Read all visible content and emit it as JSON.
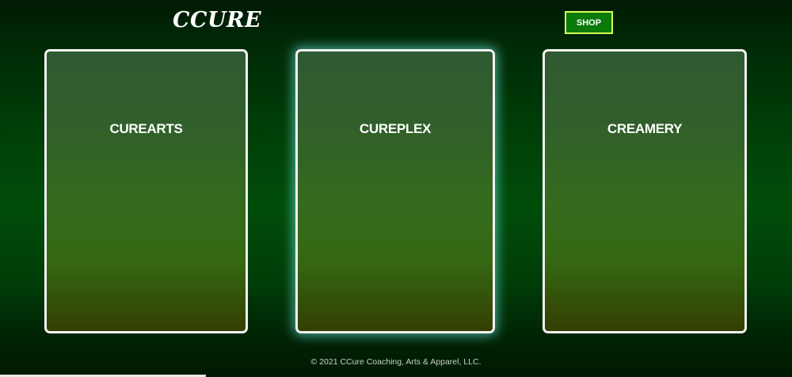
{
  "header": {
    "logo": "CCURE",
    "shop_label": "SHOP"
  },
  "cards": [
    {
      "title": "CUREARTS"
    },
    {
      "title": "CUREPLEX"
    },
    {
      "title": "CREAMERY"
    }
  ],
  "footer": {
    "copyright": "© 2021 CCure Coaching, Arts & Apparel, LLC."
  },
  "colors": {
    "shop_button_bg": "#0b7a0b",
    "shop_button_border": "#d8ff5a",
    "card_border": "#f2f2f2",
    "active_card_glow": "#78ffff"
  }
}
